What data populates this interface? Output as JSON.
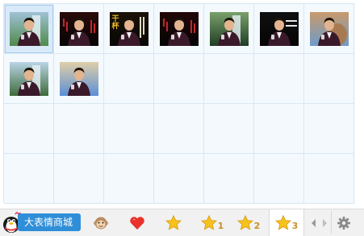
{
  "store": {
    "label": "大表情商城",
    "icon": "penguin-icon"
  },
  "tabs": [
    {
      "name": "monkey-icon",
      "label": ""
    },
    {
      "name": "heart-icon",
      "label": ""
    },
    {
      "name": "star-icon",
      "label": ""
    },
    {
      "name": "star-icon",
      "label": "1"
    },
    {
      "name": "star-icon",
      "label": "2"
    },
    {
      "name": "star-icon",
      "label": "3",
      "active": true
    }
  ],
  "nav": {
    "prev": "arrow-left-icon",
    "next": "arrow-right-icon",
    "settings": "gear-icon"
  },
  "thumbs": [
    {
      "text": "",
      "variant": "waterfall-green"
    },
    {
      "text": "",
      "variant": "dark-red"
    },
    {
      "text": "干杯",
      "variant": "dark-gold"
    },
    {
      "text": "",
      "variant": "dark-red2"
    },
    {
      "text": "",
      "variant": "waterfall"
    },
    {
      "text": "",
      "variant": "dark-white"
    },
    {
      "text": "",
      "variant": "rock"
    },
    {
      "text": "",
      "variant": "waterfall2"
    },
    {
      "text": "",
      "variant": "sky"
    }
  ],
  "colors": {
    "grid_bg": "#f3f9fd",
    "grid_line": "#d9e8f3",
    "selected": "#d8e9f9",
    "store_btn": "#2f8ed8",
    "tab_number": "#c8912a"
  }
}
